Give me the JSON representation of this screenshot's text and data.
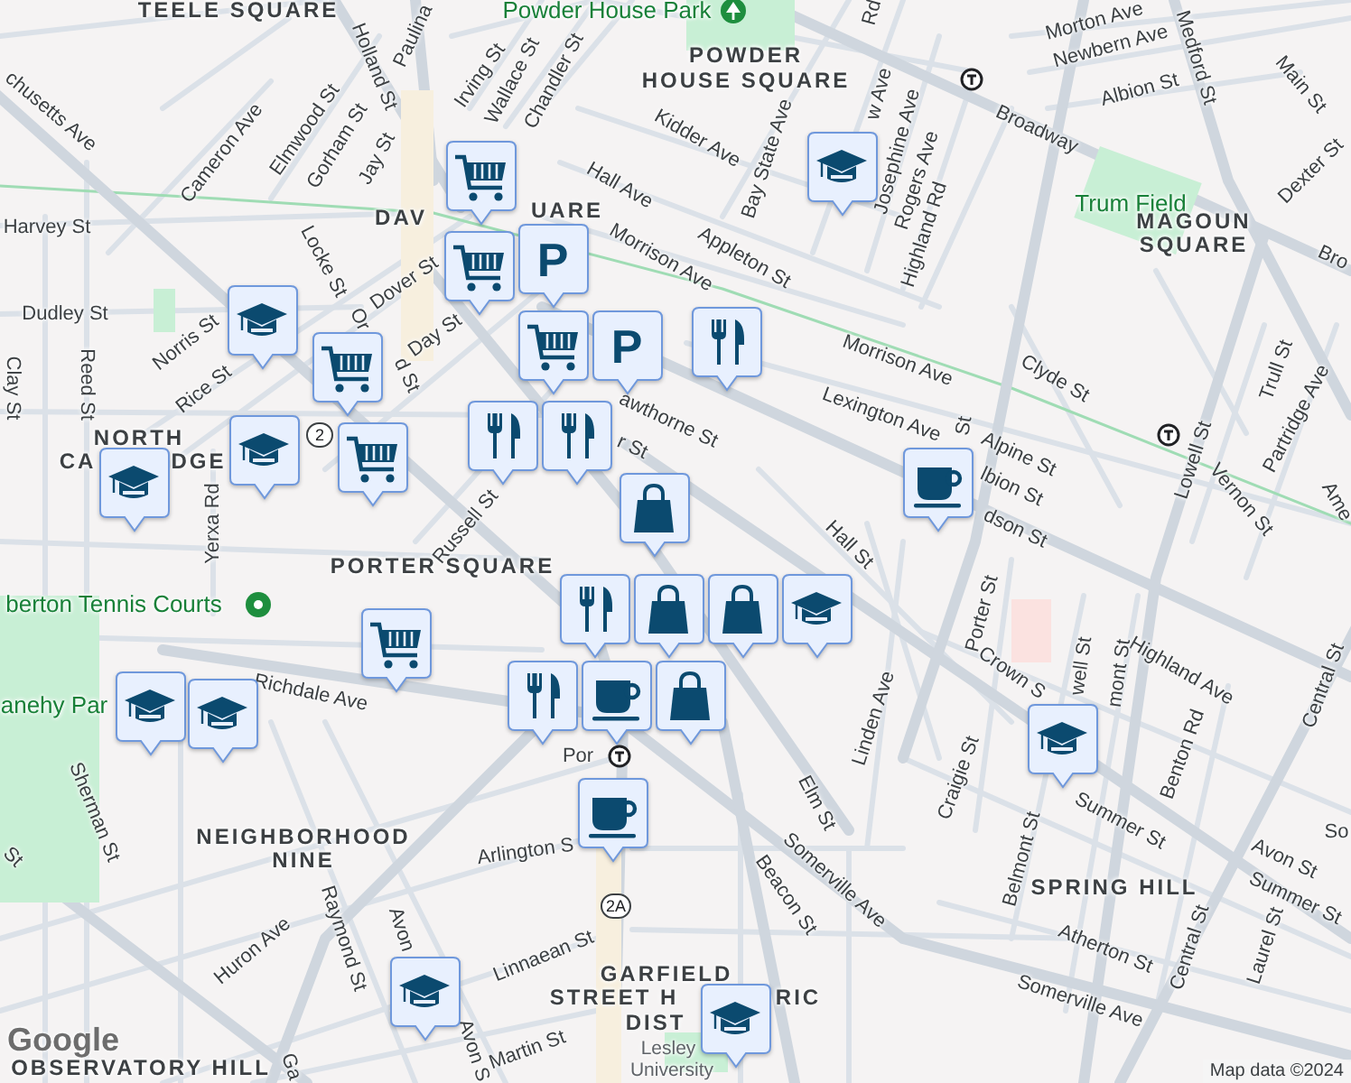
{
  "map": {
    "labels": [
      {
        "text": "TEELE SQUARE",
        "kind": "area"
      },
      {
        "text": "Powder House Park",
        "kind": "park"
      },
      {
        "text": "Rd",
        "kind": "street"
      },
      {
        "text": "Morton Ave",
        "kind": "street"
      },
      {
        "text": "Paulina",
        "kind": "street"
      },
      {
        "text": "Newbern Ave",
        "kind": "street"
      },
      {
        "text": "POWDER",
        "kind": "area"
      },
      {
        "text": "Medford St",
        "kind": "street"
      },
      {
        "text": "Holland St",
        "kind": "street"
      },
      {
        "text": "Irving St",
        "kind": "street"
      },
      {
        "text": "HOUSE SQUARE",
        "kind": "area"
      },
      {
        "text": "Wallace St",
        "kind": "street"
      },
      {
        "text": "Chandler St",
        "kind": "street"
      },
      {
        "text": "Main St",
        "kind": "street"
      },
      {
        "text": "Albion St",
        "kind": "street"
      },
      {
        "text": "w Ave",
        "kind": "street"
      },
      {
        "text": "chusetts Ave",
        "kind": "street"
      },
      {
        "text": "Elmwood St",
        "kind": "street"
      },
      {
        "text": "Broadway",
        "kind": "street"
      },
      {
        "text": "Kidder Ave",
        "kind": "street"
      },
      {
        "text": "Gorham St",
        "kind": "street"
      },
      {
        "text": "Josephine Ave",
        "kind": "street"
      },
      {
        "text": "Cameron Ave",
        "kind": "street"
      },
      {
        "text": "Bay State Ave",
        "kind": "street"
      },
      {
        "text": "Jay St",
        "kind": "street"
      },
      {
        "text": "Dexter St",
        "kind": "street"
      },
      {
        "text": "Rogers Ave",
        "kind": "street"
      },
      {
        "text": "Hall Ave",
        "kind": "street"
      },
      {
        "text": "Trum Field",
        "kind": "park"
      },
      {
        "text": "Harvey St",
        "kind": "street"
      },
      {
        "text": "DAV",
        "kind": "area"
      },
      {
        "text": "UARE",
        "kind": "area"
      },
      {
        "text": "MAGOUN",
        "kind": "area"
      },
      {
        "text": "Highland Rd",
        "kind": "street"
      },
      {
        "text": "SQUARE",
        "kind": "area"
      },
      {
        "text": "Bro",
        "kind": "street"
      },
      {
        "text": "Morrison Ave",
        "kind": "street"
      },
      {
        "text": "Appleton St",
        "kind": "street"
      },
      {
        "text": "Locke St",
        "kind": "street"
      },
      {
        "text": "Dover St",
        "kind": "street"
      },
      {
        "text": "Dudley St",
        "kind": "street"
      },
      {
        "text": "Or",
        "kind": "street"
      },
      {
        "text": "Day St",
        "kind": "street"
      },
      {
        "text": "Norris St",
        "kind": "street"
      },
      {
        "text": "Morrison Ave",
        "kind": "street"
      },
      {
        "text": "Trull St",
        "kind": "street"
      },
      {
        "text": "d St",
        "kind": "street"
      },
      {
        "text": "Clyde St",
        "kind": "street"
      },
      {
        "text": "Reed St",
        "kind": "street"
      },
      {
        "text": "Clay St",
        "kind": "street"
      },
      {
        "text": "Rice St",
        "kind": "street"
      },
      {
        "text": "Lexington Ave",
        "kind": "street"
      },
      {
        "text": "Partridge Ave",
        "kind": "street"
      },
      {
        "text": "awthorne St",
        "kind": "street"
      },
      {
        "text": "St",
        "kind": "street"
      },
      {
        "text": "NORTH",
        "kind": "area"
      },
      {
        "text": "r St",
        "kind": "street"
      },
      {
        "text": "Alpine St",
        "kind": "street"
      },
      {
        "text": "Lowell St",
        "kind": "street"
      },
      {
        "text": "CA",
        "kind": "area"
      },
      {
        "text": "DGE",
        "kind": "area"
      },
      {
        "text": "lbion St",
        "kind": "street"
      },
      {
        "text": "Russell St",
        "kind": "street"
      },
      {
        "text": "Vernon St",
        "kind": "street"
      },
      {
        "text": "Ame",
        "kind": "street"
      },
      {
        "text": "Yerxa Rd",
        "kind": "street"
      },
      {
        "text": "dson St",
        "kind": "street"
      },
      {
        "text": "Hall St",
        "kind": "street"
      },
      {
        "text": "PORTER SQUARE",
        "kind": "area"
      },
      {
        "text": "berton Tennis Courts",
        "kind": "park"
      },
      {
        "text": "Porter St",
        "kind": "street"
      },
      {
        "text": "well St",
        "kind": "street"
      },
      {
        "text": "Highland Ave",
        "kind": "street"
      },
      {
        "text": "Crown S",
        "kind": "street"
      },
      {
        "text": "mont St",
        "kind": "street"
      },
      {
        "text": "Central St",
        "kind": "street"
      },
      {
        "text": "Richdale Ave",
        "kind": "street"
      },
      {
        "text": "anehy Par",
        "kind": "park"
      },
      {
        "text": "Linden Ave",
        "kind": "street"
      },
      {
        "text": "Por",
        "kind": "street"
      },
      {
        "text": "Benton Rd",
        "kind": "street"
      },
      {
        "text": "Craigie St",
        "kind": "street"
      },
      {
        "text": "Elm St",
        "kind": "street"
      },
      {
        "text": "Sherman St",
        "kind": "street"
      },
      {
        "text": "Summer St",
        "kind": "street"
      },
      {
        "text": "So",
        "kind": "street"
      },
      {
        "text": "NEIGHBORHOOD",
        "kind": "area"
      },
      {
        "text": "Arlington S",
        "kind": "street"
      },
      {
        "text": "St",
        "kind": "street"
      },
      {
        "text": "Belmont St",
        "kind": "street"
      },
      {
        "text": "Avon St",
        "kind": "street"
      },
      {
        "text": "NINE",
        "kind": "area"
      },
      {
        "text": "Somerville Ave",
        "kind": "street"
      },
      {
        "text": "SPRING HILL",
        "kind": "area"
      },
      {
        "text": "Beacon St",
        "kind": "street"
      },
      {
        "text": "Summer St",
        "kind": "street"
      },
      {
        "text": "Avon",
        "kind": "street"
      },
      {
        "text": "Raymond St",
        "kind": "street"
      },
      {
        "text": "Laurel St",
        "kind": "street"
      },
      {
        "text": "Central St",
        "kind": "street"
      },
      {
        "text": "Atherton St",
        "kind": "street"
      },
      {
        "text": "Huron Ave",
        "kind": "street"
      },
      {
        "text": "Linnaean St",
        "kind": "street"
      },
      {
        "text": "GARFIELD",
        "kind": "area"
      },
      {
        "text": "STREET H",
        "kind": "area"
      },
      {
        "text": "RIC",
        "kind": "area"
      },
      {
        "text": "Somerville Ave",
        "kind": "street"
      },
      {
        "text": "DIST",
        "kind": "area"
      },
      {
        "text": "Avon S",
        "kind": "street"
      },
      {
        "text": "Martin St",
        "kind": "street"
      },
      {
        "text": "Lesley",
        "kind": "place"
      },
      {
        "text": "Ga",
        "kind": "street"
      },
      {
        "text": "OBSERVATORY HILL",
        "kind": "area"
      },
      {
        "text": "University",
        "kind": "place"
      }
    ],
    "route_shields": [
      {
        "text": "2"
      },
      {
        "text": "2A"
      }
    ],
    "pins": [
      {
        "kind": "school"
      },
      {
        "kind": "grocery"
      },
      {
        "kind": "grocery"
      },
      {
        "kind": "parking",
        "label": "P"
      },
      {
        "kind": "parking",
        "label": "P"
      },
      {
        "kind": "grocery"
      },
      {
        "kind": "restaurant"
      },
      {
        "kind": "restaurant"
      },
      {
        "kind": "restaurant"
      },
      {
        "kind": "school"
      },
      {
        "kind": "grocery"
      },
      {
        "kind": "school"
      },
      {
        "kind": "grocery"
      },
      {
        "kind": "school"
      },
      {
        "kind": "cafe"
      },
      {
        "kind": "shopping"
      },
      {
        "kind": "restaurant"
      },
      {
        "kind": "shopping"
      },
      {
        "kind": "shopping"
      },
      {
        "kind": "school"
      },
      {
        "kind": "restaurant"
      },
      {
        "kind": "cafe"
      },
      {
        "kind": "shopping"
      },
      {
        "kind": "cafe"
      },
      {
        "kind": "grocery"
      },
      {
        "kind": "school"
      },
      {
        "kind": "school"
      },
      {
        "kind": "school"
      },
      {
        "kind": "school"
      },
      {
        "kind": "school"
      }
    ]
  },
  "logo": "Google",
  "attribution": "Map data ©2024"
}
